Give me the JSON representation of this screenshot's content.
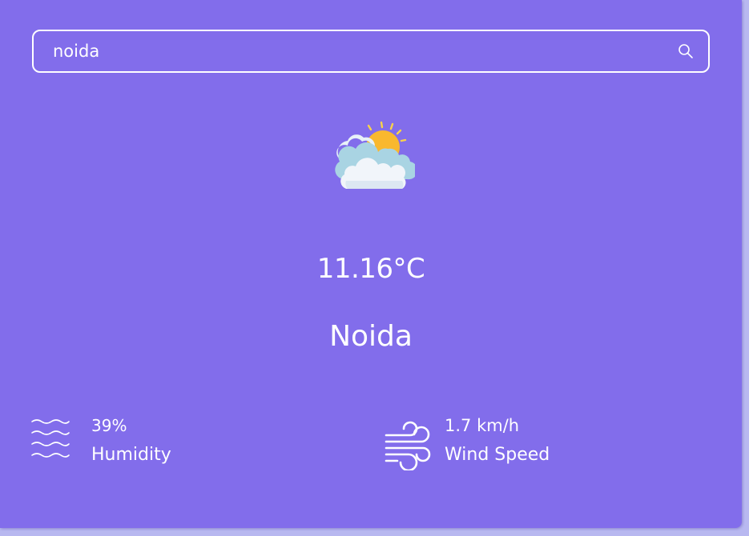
{
  "search": {
    "value": "noida",
    "icon": "search-icon"
  },
  "weather": {
    "icon": "partly-cloudy-icon",
    "temperature": "11.16°C",
    "city": "Noida"
  },
  "details": {
    "humidity": {
      "value": "39%",
      "label": "Humidity",
      "icon": "humidity-waves-icon"
    },
    "wind": {
      "value": "1.7 km/h",
      "label": "Wind Speed",
      "icon": "wind-icon"
    }
  },
  "colors": {
    "card_background": "#826deb",
    "page_background": "#b8b8f0",
    "text": "#ffffff",
    "sun": "#f9b82e",
    "cloud": "#e8f1f8",
    "cloud_shadow": "#a9d4e3"
  }
}
